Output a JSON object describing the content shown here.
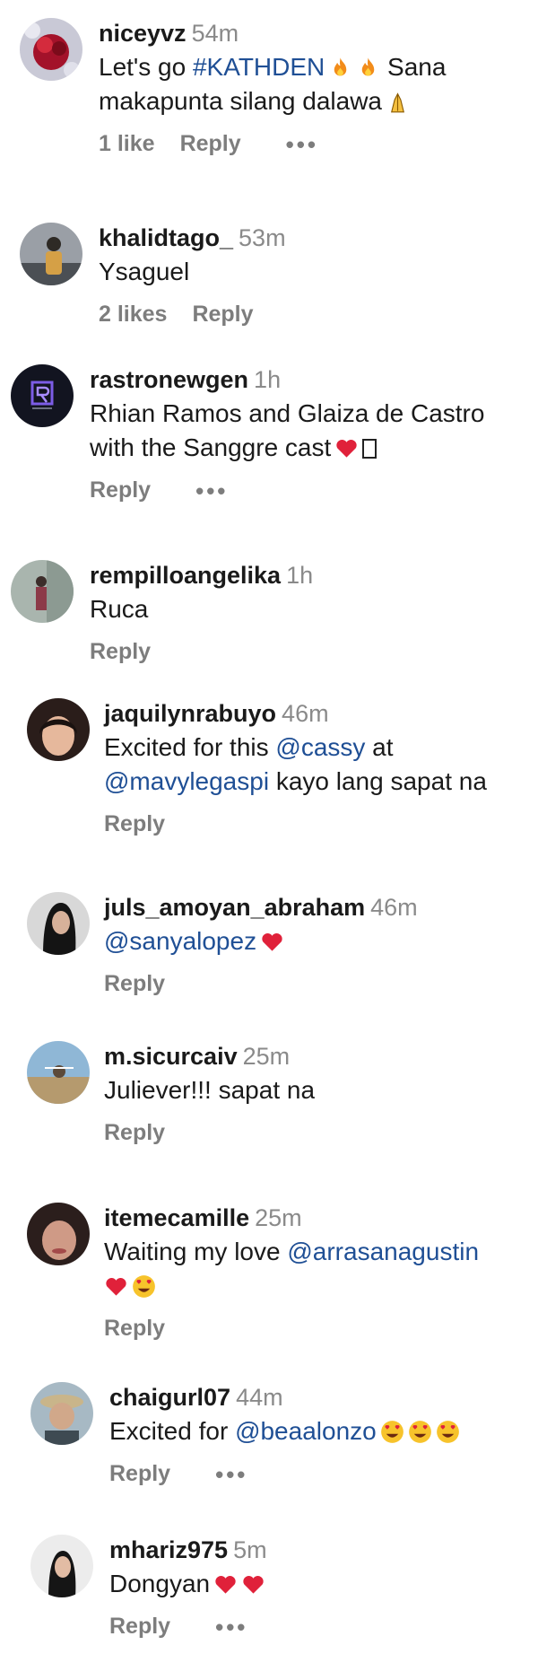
{
  "comments": [
    {
      "username": "niceyvz",
      "time": "54m",
      "text_before": "Let's go ",
      "hashtag": "#KATHDEN",
      "text_after": " Sana makapunta silang dalawa",
      "likes": "1 like",
      "reply": "Reply",
      "more": "•••"
    },
    {
      "username": "khalidtago_",
      "time": "53m",
      "text": "Ysaguel",
      "likes": "2 likes",
      "reply": "Reply"
    },
    {
      "username": "rastronewgen",
      "time": "1h",
      "text": "Rhian Ramos and Glaiza de Castro with the Sanggre cast",
      "reply": "Reply",
      "more": "•••"
    },
    {
      "username": "rempilloangelika",
      "time": "1h",
      "text": "Ruca",
      "reply": "Reply"
    },
    {
      "username": "jaquilynrabuyo",
      "time": "46m",
      "text_before": "Excited for this ",
      "mention1": "@cassy",
      "text_mid": " at ",
      "mention2": "@mavylegaspi",
      "text_after": " kayo lang sapat na",
      "reply": "Reply"
    },
    {
      "username": "juls_amoyan_abraham",
      "time": "46m",
      "mention": "@sanyalopez",
      "reply": "Reply"
    },
    {
      "username": "m.sicurcaiv",
      "time": "25m",
      "text": "Juliever!!! sapat na",
      "reply": "Reply"
    },
    {
      "username": "itemecamille",
      "time": "25m",
      "text_before": "Waiting my love ",
      "mention": "@arrasanagustin",
      "reply": "Reply"
    },
    {
      "username": "chaigurl07",
      "time": "44m",
      "text_before": "Excited for ",
      "mention": "@beaalonzo",
      "reply": "Reply",
      "more": "•••"
    },
    {
      "username": "mhariz975",
      "time": "5m",
      "text": "Dongyan",
      "reply": "Reply",
      "more": "•••"
    }
  ]
}
